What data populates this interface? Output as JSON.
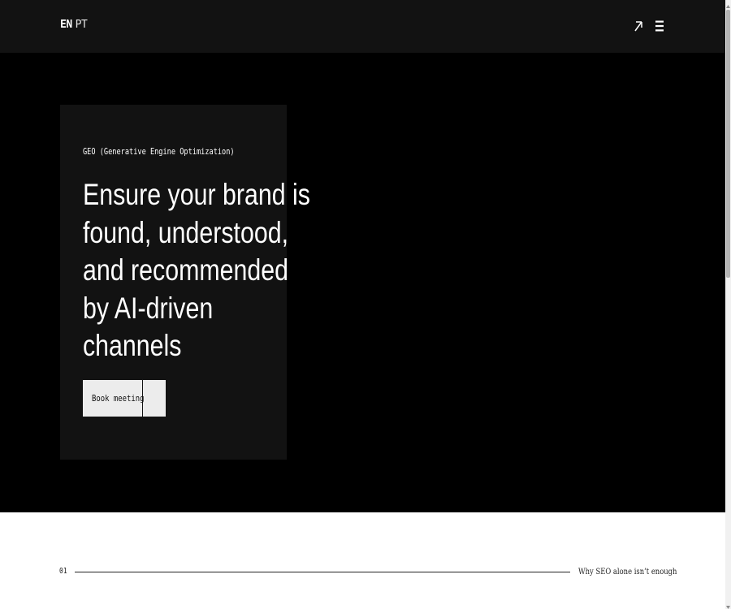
{
  "header": {
    "lang_active": "EN",
    "lang_other": "PT",
    "external_link_icon": "arrow-up-right-icon",
    "menu_icon": "hamburger-menu-icon"
  },
  "hero": {
    "eyebrow": "GEO (Generative Engine Optimization)",
    "headline_lines": [
      "Ensure your brand is",
      "found, understood,",
      "and recommended",
      "by AI-driven",
      "channels"
    ],
    "cta_label": "Book meeting"
  },
  "section": {
    "number": "01",
    "title": "Why SEO alone isn’t enough"
  },
  "colors": {
    "topbar": "#121212",
    "hero_bg": "#000000",
    "card_bg": "#121212",
    "button_bg": "#ececec",
    "text_light": "#ffffff",
    "text_dark": "#222222"
  }
}
